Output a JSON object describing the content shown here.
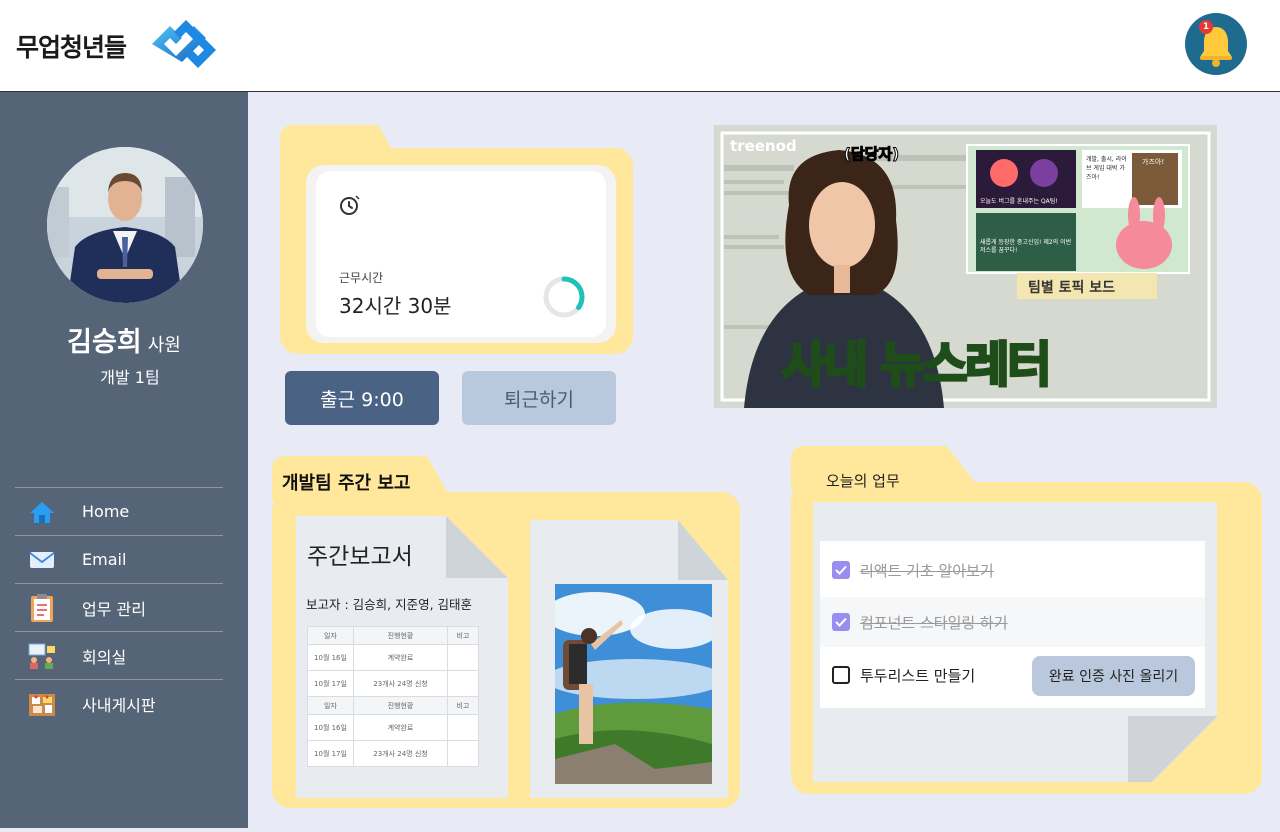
{
  "brand": {
    "name": "무업청년들"
  },
  "notification": {
    "count": "1"
  },
  "profile": {
    "name": "김승희",
    "rank": "사원",
    "team": "개발 1팀"
  },
  "nav": {
    "items": [
      {
        "label": "Home",
        "icon": "home-icon"
      },
      {
        "label": "Email",
        "icon": "email-icon"
      },
      {
        "label": "업무 관리",
        "icon": "clipboard-icon"
      },
      {
        "label": "회의실",
        "icon": "meeting-room-icon"
      },
      {
        "label": "사내게시판",
        "icon": "bulletin-board-icon"
      }
    ]
  },
  "work_time": {
    "label": "근무시간",
    "value": "32시간 30분",
    "progress": 0.35
  },
  "attendance": {
    "clock_in_label": "출근 9:00",
    "clock_out_label": "퇴근하기"
  },
  "newsletter": {
    "channel": "treenod",
    "speaker": "(담당자)",
    "headline_a": "사내",
    "headline_b": "뉴스레터",
    "board_label": "팀별 토픽 보드",
    "card1": "오늘도 버그를 혼내주는 QA팀!",
    "card2": "개발, 출시, 라이브 게임 대박 가즈아!",
    "card3": "새롭게 등장한 중고신입! 제2의 이번저스를 꿈꾸다!",
    "card4": "가즈아!"
  },
  "weekly_report": {
    "title": "개발팀 주간 보고",
    "doc_title": "주간보고서",
    "authors": "보고자 : 김승희, 지준영, 김태훈",
    "table": {
      "headers": [
        "일자",
        "진행현황",
        "비고"
      ],
      "rows": [
        [
          "10월 16일",
          "계약완료",
          ""
        ],
        [
          "10월 17일",
          "23개사 24명 신청",
          ""
        ]
      ]
    }
  },
  "tasks": {
    "title": "오늘의 업무",
    "items": [
      {
        "label": "리액트 기초 알아보기",
        "done": true
      },
      {
        "label": "컴포넌트 스타일링 하기",
        "done": true
      },
      {
        "label": "투두리스트 만들기",
        "done": false
      }
    ],
    "upload_label": "완료 인증 사진 올리기"
  },
  "colors": {
    "sidebar": "#566477",
    "folder": "#ffe89b",
    "primary_button": "#4a6283",
    "secondary_button": "#b9c8dc",
    "check": "#9a8cf0"
  }
}
